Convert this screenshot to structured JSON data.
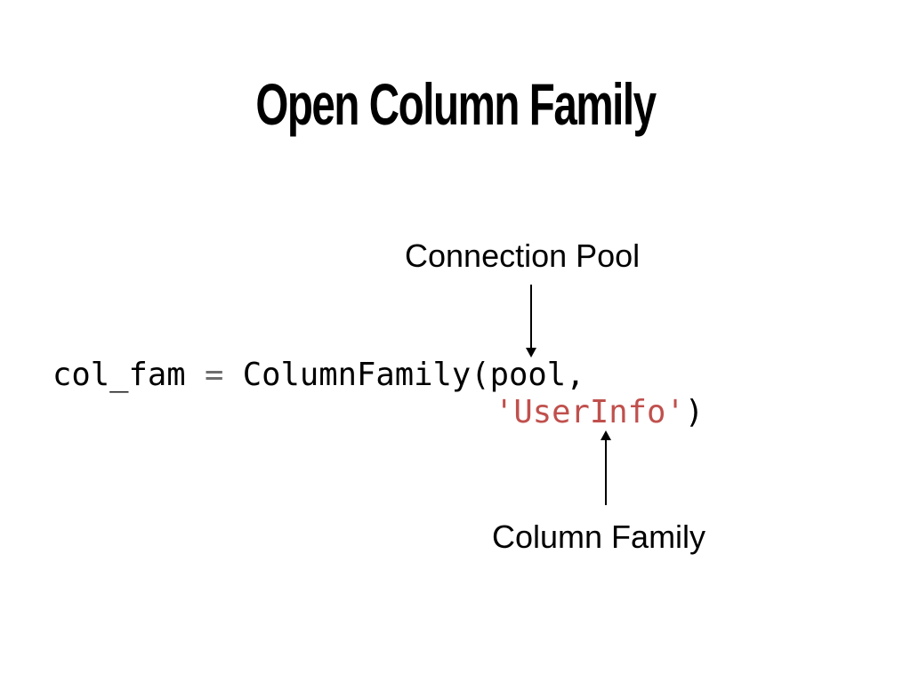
{
  "slide": {
    "title": "Open Column Family",
    "labels": {
      "connection_pool": "Connection Pool",
      "column_family": "Column Family"
    },
    "code": {
      "line1_prefix": "col_fam",
      "line1_operator": " = ",
      "line1_call": "ColumnFamily(pool,",
      "line2_string": "'UserInfo'",
      "line2_suffix": ")"
    },
    "colors": {
      "background": "#ffffff",
      "text": "#000000",
      "string_literal": "#c0504d",
      "operator": "#6e6e6e"
    }
  }
}
